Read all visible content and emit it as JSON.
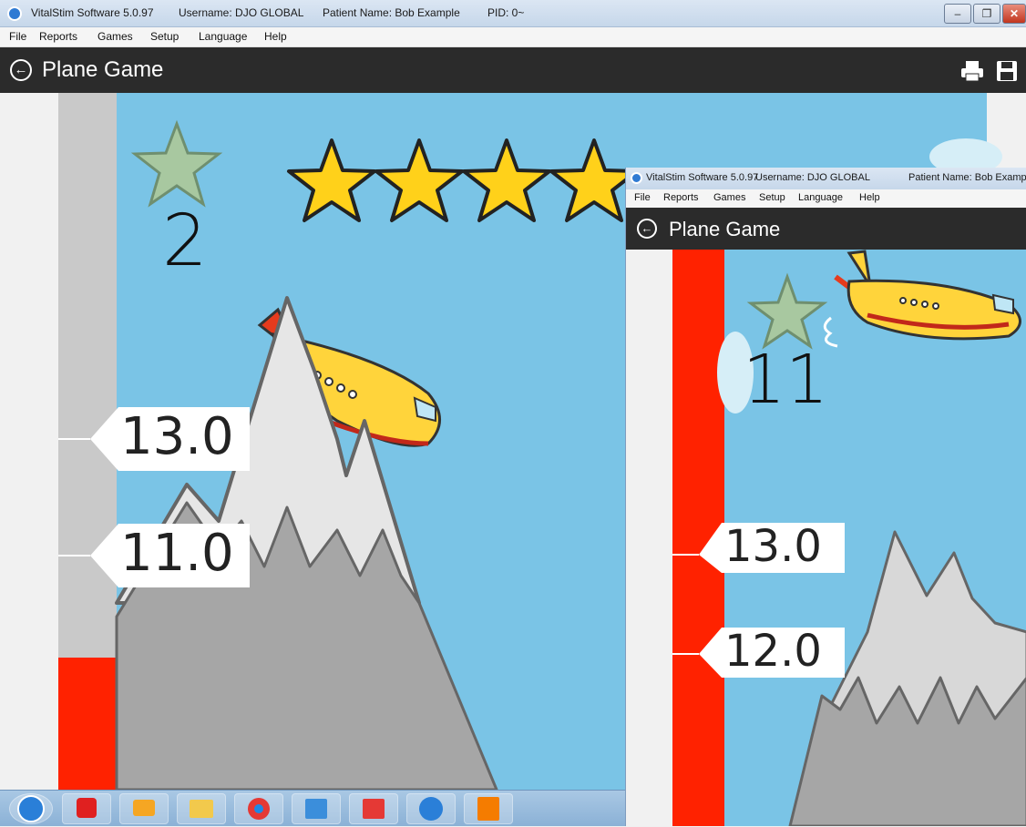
{
  "window": {
    "app_name": "VitalStim Software 5.0.97",
    "username": "Username: DJO GLOBAL",
    "patient": "Patient Name: Bob Example",
    "pid": "PID: 0~",
    "controls": {
      "minimize": "–",
      "maximize": "❐",
      "close": "✕"
    }
  },
  "menu": {
    "items": [
      "File",
      "Reports",
      "Games",
      "Setup",
      "Language",
      "Help"
    ]
  },
  "header": {
    "title": "Plane Game",
    "back_icon": "back-arrow-icon",
    "print_icon": "printer-icon",
    "save_icon": "save-icon"
  },
  "game": {
    "score": "2",
    "stars_earned": 4,
    "markers": [
      {
        "label": "13.0"
      },
      {
        "label": "11.0"
      }
    ],
    "meter_level": 0.19,
    "colors": {
      "sky": "#7ac4e6",
      "meter_track": "#c9c9c9",
      "meter_fill": "#ff2200",
      "star_gold": "#ffd11a",
      "star_pale": "#a8c8a0",
      "mountain": "#a6a6a6",
      "snow": "#e6e6e6"
    }
  },
  "taskbar": {
    "icons": [
      "start-orb-icon",
      "fortinet-icon",
      "outlook-icon",
      "file-explorer-icon",
      "chrome-icon",
      "remote-desktop-icon",
      "ec-app-icon",
      "vitalstim-icon",
      "pdf-icon"
    ]
  },
  "window2": {
    "app_name": "VitalStim Software 5.0.97",
    "username": "Username: DJO GLOBAL",
    "patient": "Patient Name: Bob Examp",
    "menu": [
      "File",
      "Reports",
      "Games",
      "Setup",
      "Language",
      "Help"
    ],
    "title": "Plane Game",
    "score": "11",
    "markers": [
      {
        "label": "13.0"
      },
      {
        "label": "12.0"
      }
    ],
    "meter_level": 1.0
  }
}
